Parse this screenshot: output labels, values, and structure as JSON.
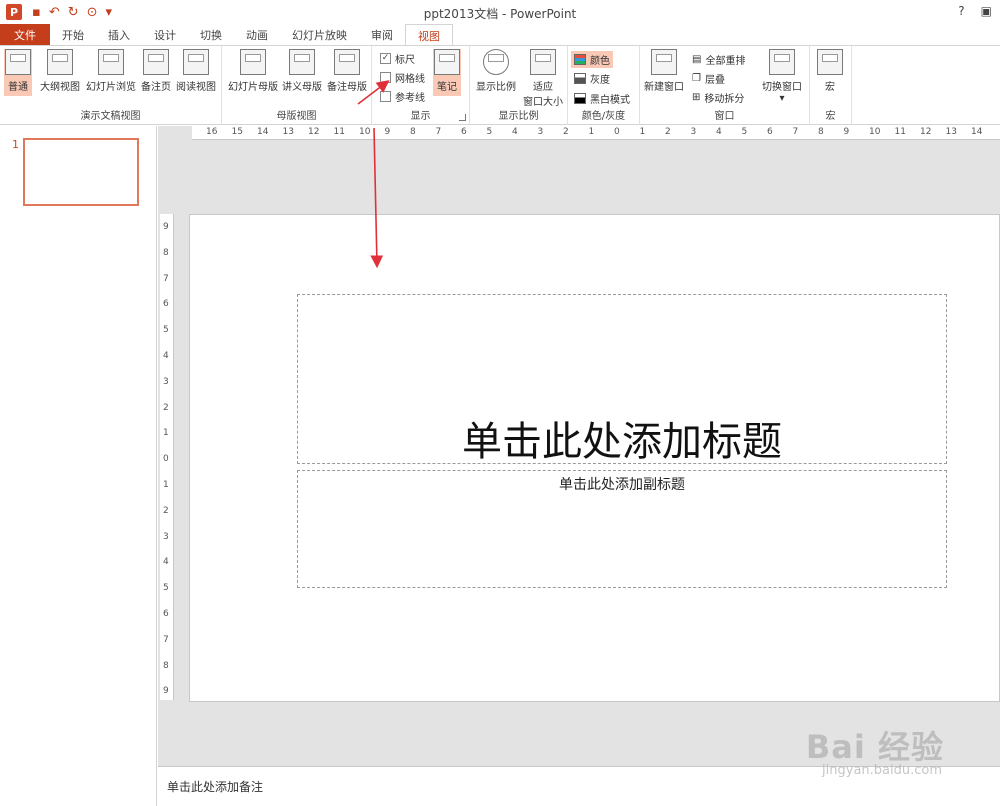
{
  "window": {
    "title": "ppt2013文档 - PowerPoint",
    "help": "?",
    "restore": "▣",
    "app_icon_letter": "P"
  },
  "tabs": {
    "file": "文件",
    "items": [
      "开始",
      "插入",
      "设计",
      "切换",
      "动画",
      "幻灯片放映",
      "审阅",
      "视图"
    ],
    "active": "视图"
  },
  "ribbon": {
    "presentation_views": {
      "label": "演示文稿视图",
      "buttons": [
        "普通",
        "大纲视图",
        "幻灯片浏览",
        "备注页",
        "阅读视图"
      ]
    },
    "master_views": {
      "label": "母版视图",
      "buttons": [
        "幻灯片母版",
        "讲义母版",
        "备注母版"
      ]
    },
    "show": {
      "label": "显示",
      "ruler": "标尺",
      "gridlines": "网格线",
      "guides": "参考线",
      "notes": "笔记",
      "ruler_checked": true
    },
    "zoom": {
      "label": "显示比例",
      "zoom": "显示比例",
      "fit_line1": "适应",
      "fit_line2": "窗口大小"
    },
    "color": {
      "label": "颜色/灰度",
      "color": "颜色",
      "grayscale": "灰度",
      "bw": "黑白模式"
    },
    "window": {
      "label": "窗口",
      "new_window": "新建窗口",
      "arrange_all": "全部重排",
      "cascade": "层叠",
      "move_split": "移动拆分",
      "switch": "切换窗口"
    },
    "macros": {
      "label": "宏",
      "macro": "宏"
    }
  },
  "slides_pane": {
    "slide_number": "1"
  },
  "slide": {
    "title_placeholder": "单击此处添加标题",
    "subtitle_placeholder": "单击此处添加副标题"
  },
  "notes": {
    "placeholder": "单击此处添加备注"
  },
  "ruler": {
    "h_labels": [
      "16",
      "15",
      "14",
      "13",
      "12",
      "11",
      "10",
      "9",
      "8",
      "7",
      "6",
      "5",
      "4",
      "3",
      "2",
      "1",
      "0",
      "1",
      "2",
      "3",
      "4",
      "5",
      "6",
      "7",
      "8",
      "9",
      "10",
      "11",
      "12",
      "13",
      "14"
    ],
    "v_labels": [
      "9",
      "8",
      "7",
      "6",
      "5",
      "4",
      "3",
      "2",
      "1",
      "0",
      "1",
      "2",
      "3",
      "4",
      "5",
      "6",
      "7",
      "8",
      "9"
    ]
  },
  "watermark": {
    "brand": "Bai 经验",
    "url": "jingyan.baidu.com"
  },
  "colors": {
    "accent": "#c43e1c",
    "arrow": "#e0303a",
    "selection": "#f9c9b6"
  }
}
